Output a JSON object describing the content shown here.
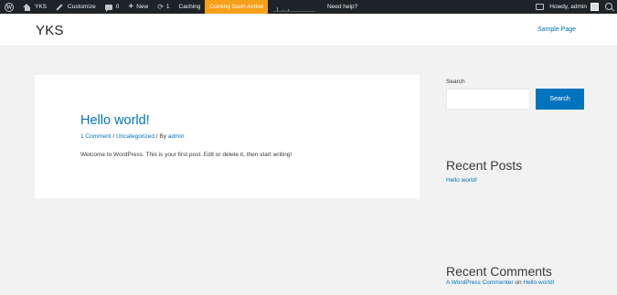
{
  "adminbar": {
    "site_name": "YKS",
    "customize": "Customize",
    "comments_count": "0",
    "new_label": "New",
    "updates_count": "1",
    "caching": "Caching",
    "coming_soon": "Coming Soon Active",
    "need_help": "Need help?",
    "howdy": "Howdy, admin",
    "colors": {
      "background": "#1d2327",
      "coming_soon": "#f6a01a"
    }
  },
  "header": {
    "site_title": "YKS",
    "nav": [
      {
        "label": "Sample Page"
      }
    ]
  },
  "post": {
    "title": "Hello world!",
    "meta": {
      "comments": "1 Comment",
      "sep1": " / ",
      "category": "Uncategorized",
      "sep2": " / By ",
      "author": "admin"
    },
    "body": "Welcome to WordPress. This is your first post. Edit or delete it, then start writing!"
  },
  "sidebar": {
    "search": {
      "label": "Search",
      "placeholder": "",
      "button": "Search"
    },
    "recent_posts": {
      "title": "Recent Posts",
      "items": [
        "Hello world!"
      ]
    },
    "recent_comments": {
      "title": "Recent Comments",
      "items": [
        {
          "author": "A WordPress Commenter",
          "on": " on ",
          "post": "Hello world!"
        }
      ]
    }
  },
  "colors": {
    "link": "#0274be",
    "button": "#0274be",
    "page_bg": "#f2f2f2"
  }
}
